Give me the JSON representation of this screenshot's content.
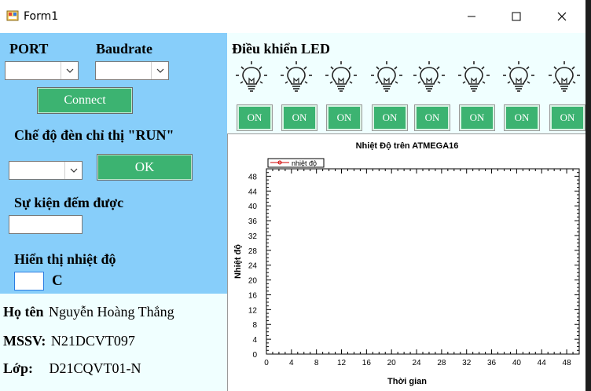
{
  "window": {
    "title": "Form1",
    "minimize_icon": "minimize-icon",
    "maximize_icon": "maximize-icon",
    "close_icon": "close-icon"
  },
  "serial": {
    "port_label": "PORT",
    "baudrate_label": "Baudrate",
    "port_value": "",
    "baudrate_value": "",
    "connect_label": "Connect"
  },
  "run_led": {
    "label": "Chế độ đèn chỉ thị \"RUN\"",
    "mode_value": "",
    "ok_label": "OK"
  },
  "event_count": {
    "label": "Sự kiện đếm được",
    "value": ""
  },
  "temperature": {
    "label": "Hiển thị nhiệt độ",
    "value": "",
    "unit": "C"
  },
  "info": {
    "name_label": "Họ tên",
    "name_value": "Nguyễn Hoàng Thắng",
    "id_label": "MSSV:",
    "id_value": "N21DCVT097",
    "class_label": "Lớp:",
    "class_value": "D21CQVT01-N"
  },
  "led_control": {
    "title": "Điều khiển LED",
    "buttons": [
      "ON",
      "ON",
      "ON",
      "ON",
      "ON",
      "ON",
      "ON",
      "ON"
    ],
    "icon": "lightbulb-icon"
  },
  "chart_data": {
    "type": "line",
    "title": "Nhiệt Độ trên ATMEGA16",
    "xlabel": "Thời gian",
    "ylabel": "Nhiệt độ",
    "xlim": [
      0,
      50
    ],
    "ylim": [
      0,
      50
    ],
    "xticks": [
      0,
      4,
      8,
      12,
      16,
      20,
      24,
      28,
      32,
      36,
      40,
      44,
      48
    ],
    "yticks": [
      0,
      4,
      8,
      12,
      16,
      20,
      24,
      28,
      32,
      36,
      40,
      44,
      48
    ],
    "legend_position": "top-left",
    "grid": false,
    "series": [
      {
        "name": "nhiệt độ",
        "color": "#d00000",
        "x": [],
        "y": []
      }
    ]
  }
}
